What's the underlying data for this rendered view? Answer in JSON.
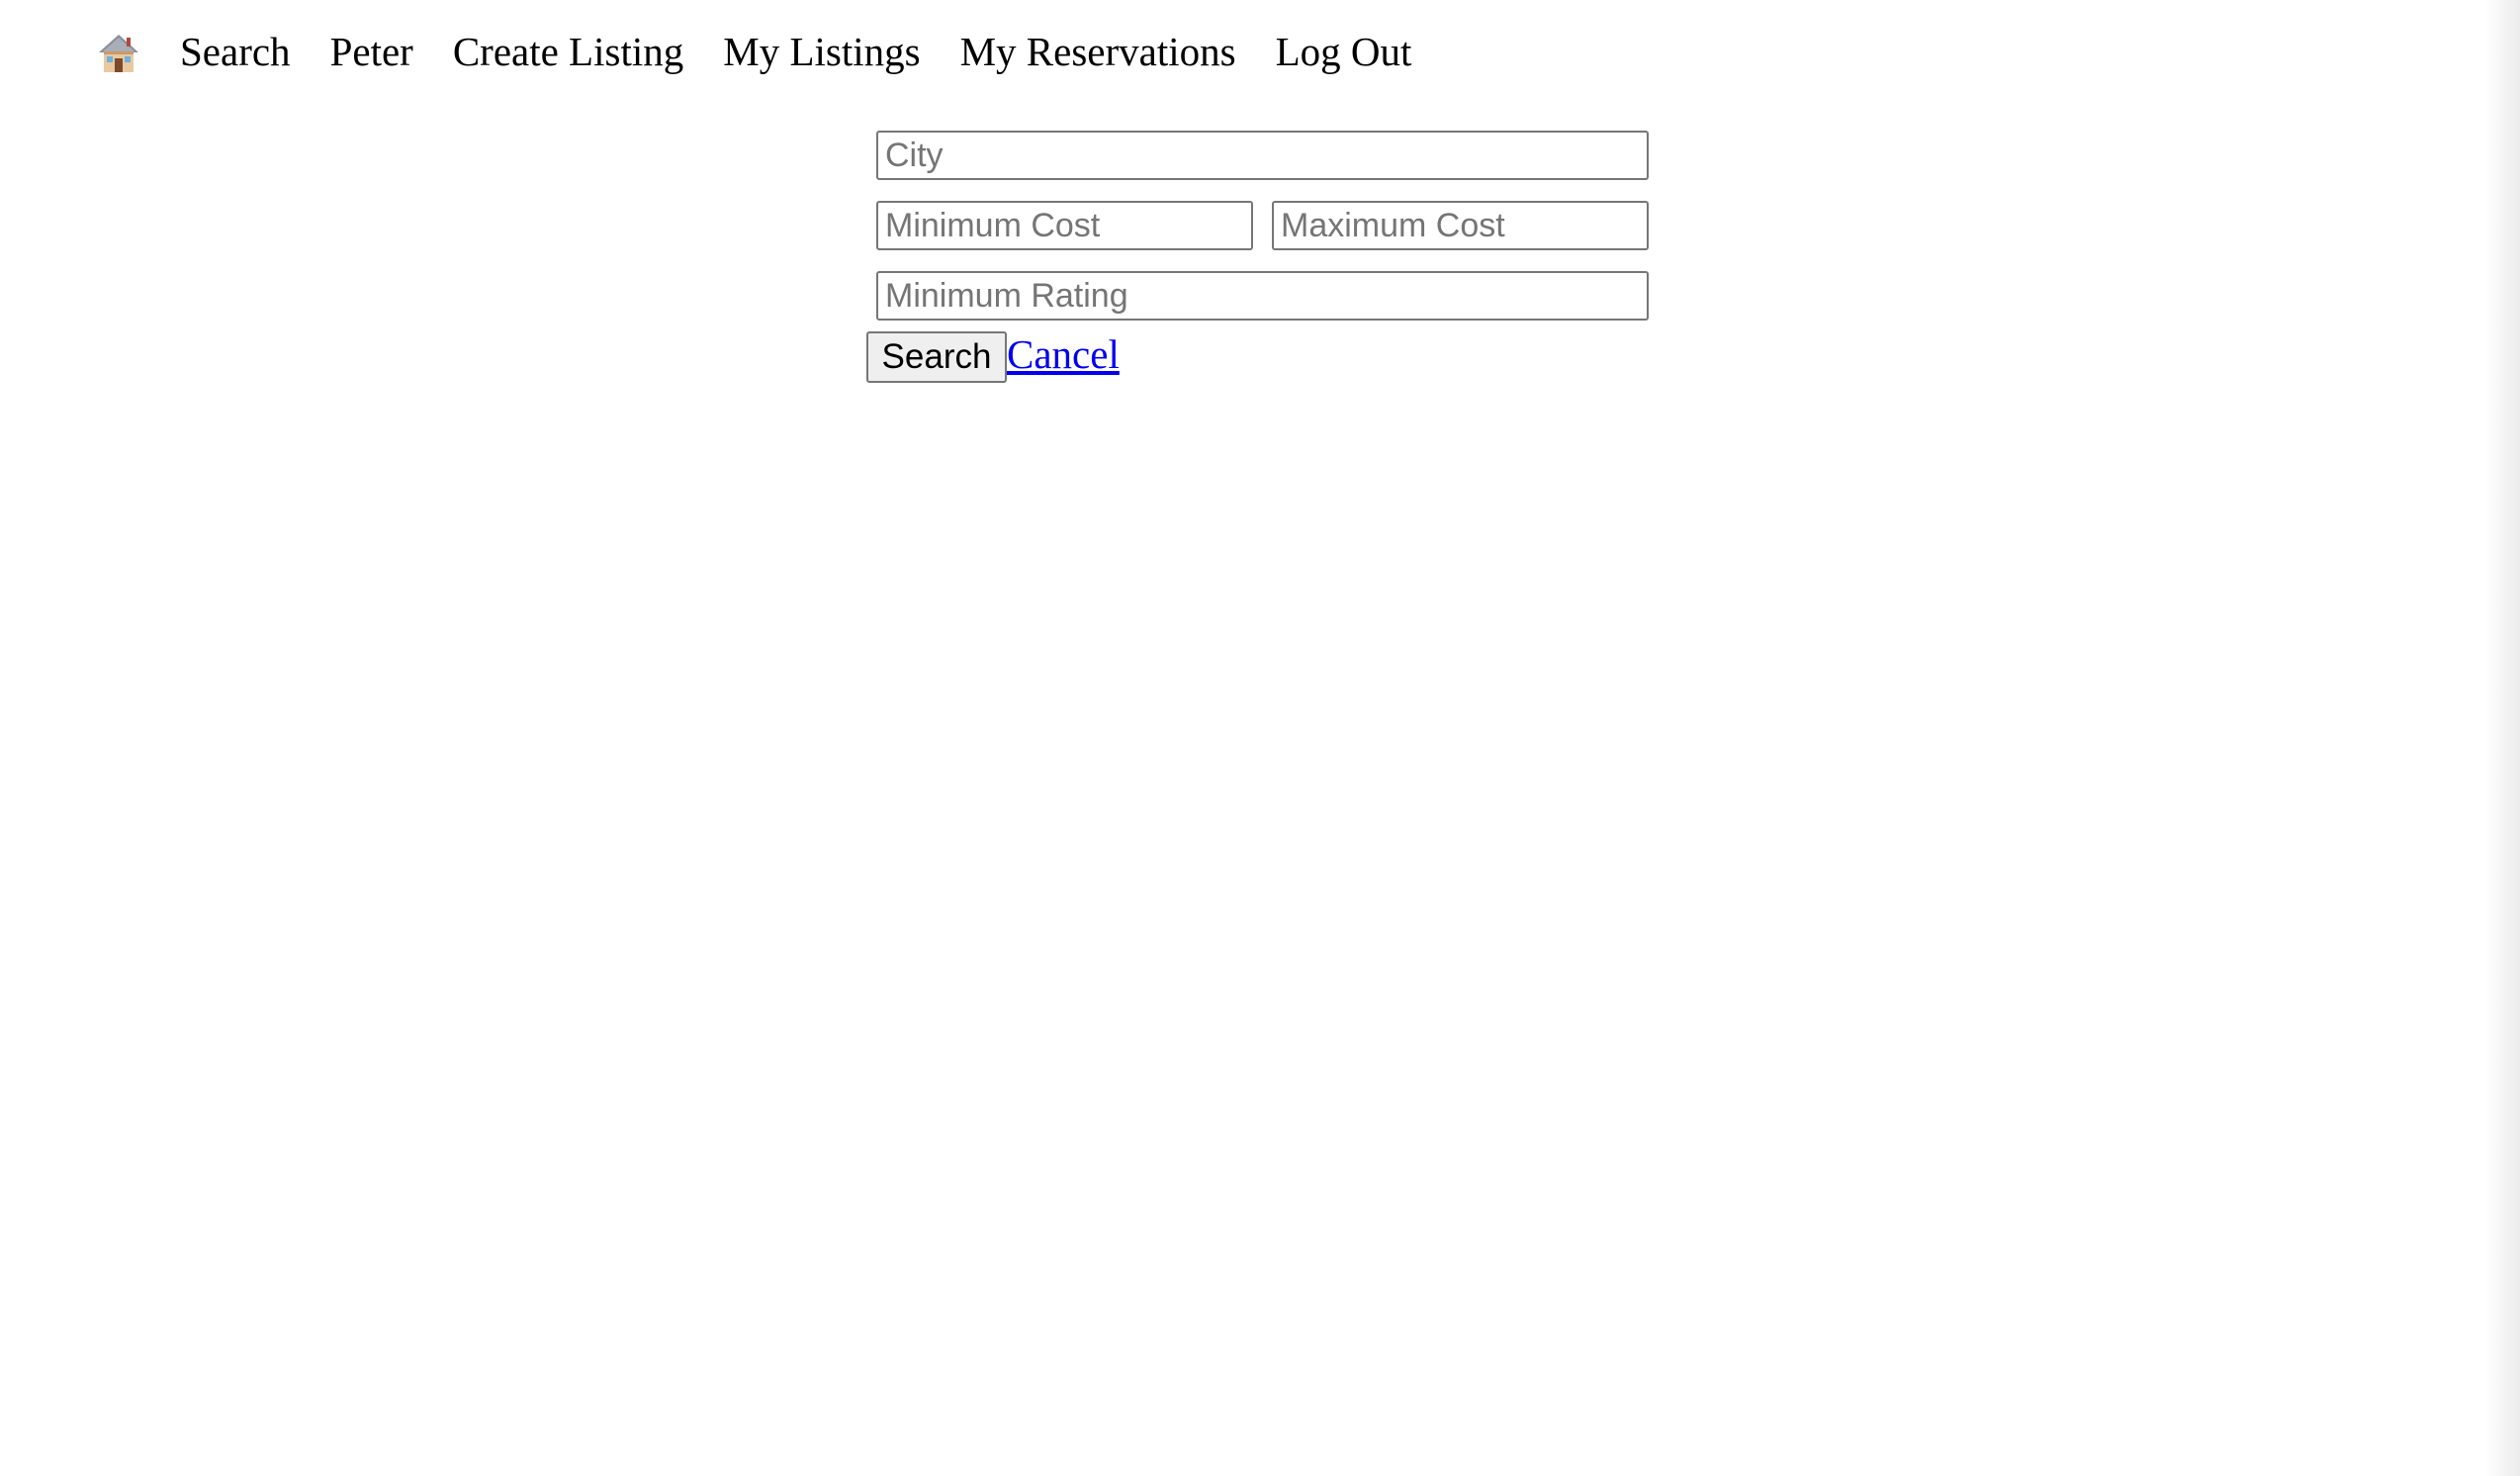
{
  "nav": {
    "home_icon": "house-icon",
    "items": [
      {
        "label": "Search"
      },
      {
        "label": "Peter"
      },
      {
        "label": "Create Listing"
      },
      {
        "label": "My Listings"
      },
      {
        "label": "My Reservations"
      },
      {
        "label": "Log Out"
      }
    ]
  },
  "search_form": {
    "city": {
      "value": "",
      "placeholder": "City"
    },
    "min_cost": {
      "value": "",
      "placeholder": "Minimum Cost"
    },
    "max_cost": {
      "value": "",
      "placeholder": "Maximum Cost"
    },
    "min_rating": {
      "value": "",
      "placeholder": "Minimum Rating"
    },
    "submit_label": "Search",
    "cancel_label": "Cancel"
  },
  "colors": {
    "link": "#0000ee",
    "text": "#000000",
    "input_border": "#767676",
    "button_bg": "#efefef"
  }
}
